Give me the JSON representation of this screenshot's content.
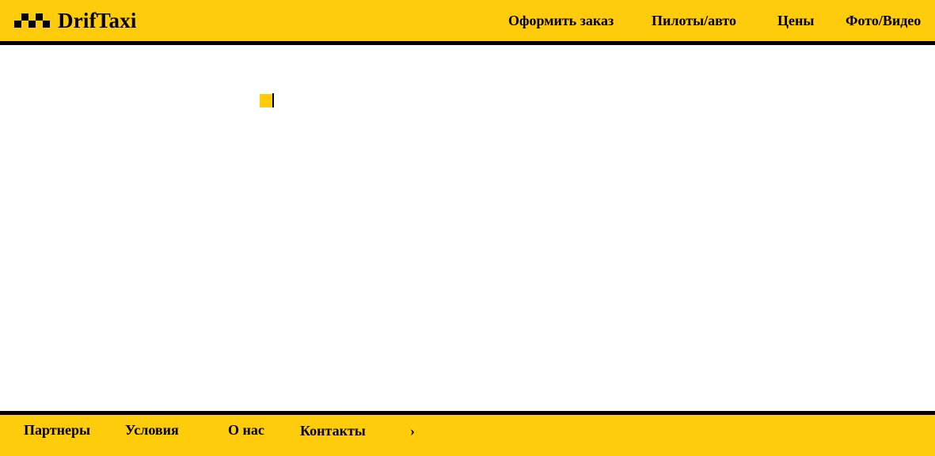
{
  "brand": {
    "name": "DrifTaxi",
    "logo_icon": "taxi-checker-icon"
  },
  "nav": {
    "order": "Оформить заказ",
    "pilots": "Пилоты/авто",
    "prices": "Цены",
    "media": "Фото/Видео"
  },
  "footer": {
    "partners": "Партнеры",
    "terms": "Условия",
    "about": "О нас",
    "contacts": "Контакты",
    "more": "›"
  },
  "colors": {
    "accent": "#FFCC0C",
    "border": "#000000",
    "background": "#FFFFFF"
  }
}
